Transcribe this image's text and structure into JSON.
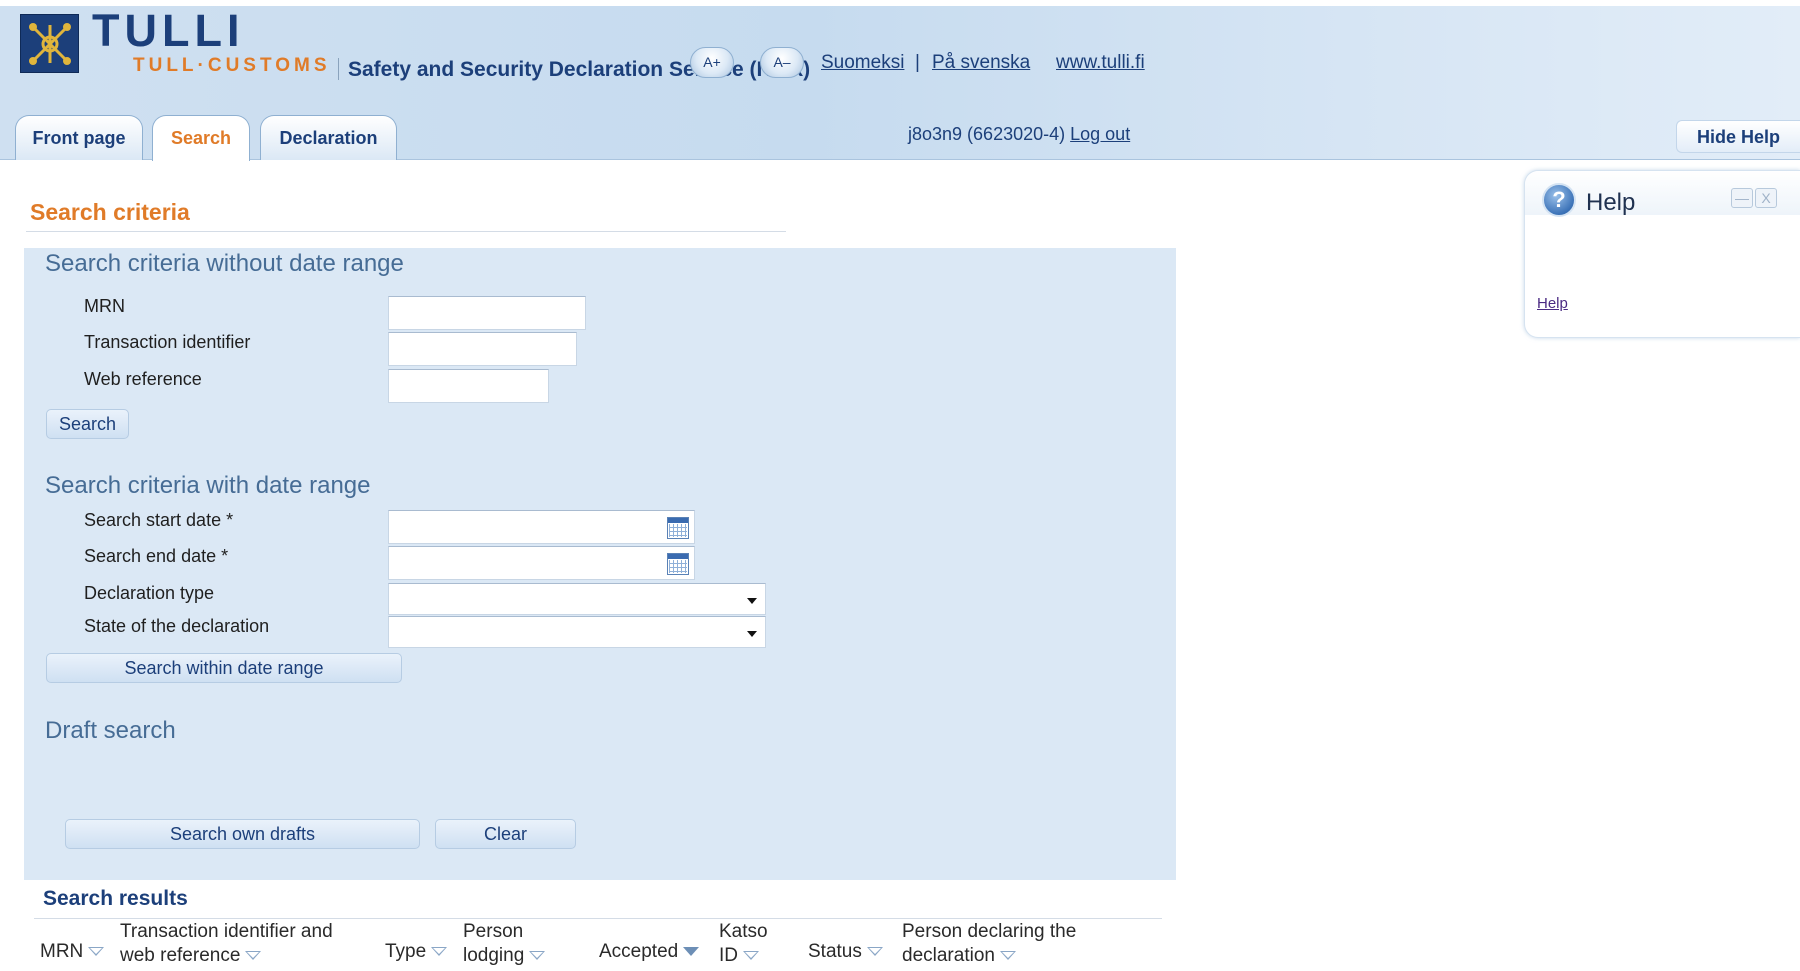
{
  "header": {
    "brand_main": "TULLI",
    "brand_sub": "TULL·CUSTOMS",
    "service_title": "Safety and Security Declaration Service (ITEX)",
    "font_larger": "A+",
    "font_smaller": "A–",
    "lang_fi": "Suomeksi",
    "lang_separator": "|",
    "lang_sv": "På svenska",
    "site_link": "www.tulli.fi",
    "user": "j8o3n9 (6623020-4)",
    "logout": "Log out",
    "hide_help": "Hide Help"
  },
  "tabs": [
    {
      "label": "Front page"
    },
    {
      "label": "Search"
    },
    {
      "label": "Declaration"
    }
  ],
  "page_title": "Search criteria",
  "no_date_section": {
    "heading": "Search criteria without date range",
    "mrn_label": "MRN",
    "mrn_value": "",
    "transaction_label": "Transaction identifier",
    "transaction_value": "",
    "webref_label": "Web reference",
    "webref_value": "",
    "search_button": "Search"
  },
  "date_section": {
    "heading": "Search criteria with date range",
    "start_label": "Search start date *",
    "start_value": "",
    "end_label": "Search end date *",
    "end_value": "",
    "type_label": "Declaration type",
    "type_value": "",
    "state_label": "State of the declaration",
    "state_value": "",
    "search_button": "Search within date range"
  },
  "draft_section": {
    "heading": "Draft search",
    "search_button": "Search own drafts",
    "clear_button": "Clear"
  },
  "help": {
    "title": "Help",
    "icon": "?",
    "minimize": "—",
    "close": "X",
    "link": "Help"
  },
  "results": {
    "heading": "Search results",
    "columns": [
      {
        "line1": "MRN",
        "line2": ""
      },
      {
        "line1": "Transaction identifier and",
        "line2": "web reference"
      },
      {
        "line1": "Type",
        "line2": ""
      },
      {
        "line1": "Person",
        "line2": "lodging"
      },
      {
        "line1": "Accepted",
        "line2": ""
      },
      {
        "line1": "Katso",
        "line2": "ID"
      },
      {
        "line1": "Status",
        "line2": ""
      },
      {
        "line1": "Person declaring the",
        "line2": "declaration"
      }
    ]
  }
}
